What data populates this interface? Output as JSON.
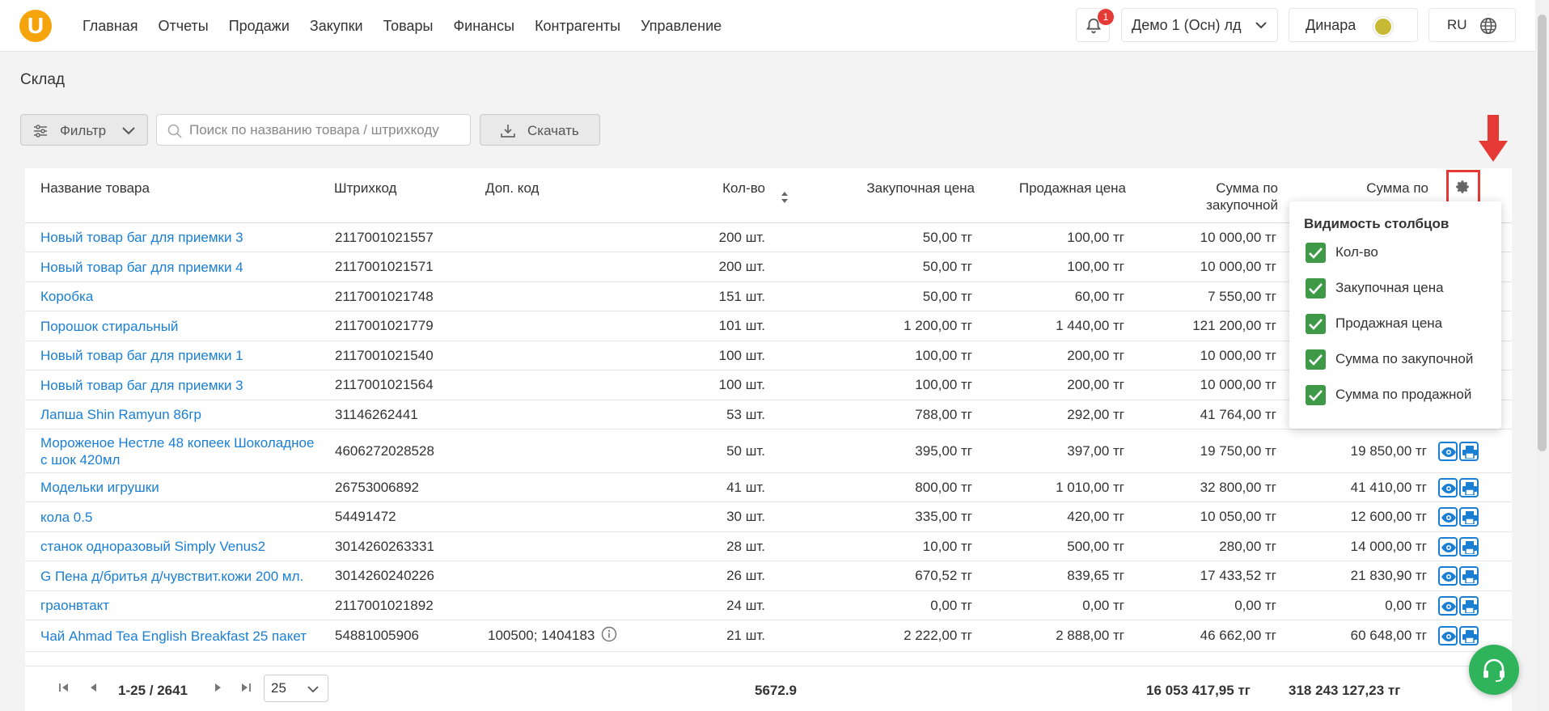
{
  "header": {
    "logo_letter": "U",
    "nav": [
      "Главная",
      "Отчеты",
      "Продажи",
      "Закупки",
      "Товары",
      "Финансы",
      "Контрагенты",
      "Управление"
    ],
    "notifications_count": "1",
    "store": "Демо 1 (Осн) лд",
    "user": "Динара",
    "language": "RU"
  },
  "page": {
    "title": "Склад",
    "filter_label": "Фильтр",
    "search_placeholder": "Поиск по названию товара / штрихкоду",
    "download_label": "Скачать"
  },
  "table": {
    "columns": {
      "name": "Название товара",
      "barcode": "Штрихкод",
      "extra_code": "Доп. код",
      "qty": "Кол-во",
      "purchase_price": "Закупочная цена",
      "sale_price": "Продажная цена",
      "sum_purchase": "Сумма по закупочной",
      "sum_sale": "Сумма по"
    },
    "rows": [
      {
        "name": "Новый товар баг для приемки 3",
        "barcode": "2117001021557",
        "extra": "",
        "qty": "200 шт.",
        "purchase": "50,00 тг",
        "sale": "100,00 тг",
        "sum_purchase": "10 000,00 тг",
        "sum_sale": ""
      },
      {
        "name": "Новый товар баг для приемки 4",
        "barcode": "2117001021571",
        "extra": "",
        "qty": "200 шт.",
        "purchase": "50,00 тг",
        "sale": "100,00 тг",
        "sum_purchase": "10 000,00 тг",
        "sum_sale": ""
      },
      {
        "name": "Коробка",
        "barcode": "2117001021748",
        "extra": "",
        "qty": "151 шт.",
        "purchase": "50,00 тг",
        "sale": "60,00 тг",
        "sum_purchase": "7 550,00 тг",
        "sum_sale": ""
      },
      {
        "name": "Порошок стиральный",
        "barcode": "2117001021779",
        "extra": "",
        "qty": "101 шт.",
        "purchase": "1 200,00 тг",
        "sale": "1 440,00 тг",
        "sum_purchase": "121 200,00 тг",
        "sum_sale": ""
      },
      {
        "name": "Новый товар баг для приемки 1",
        "barcode": "2117001021540",
        "extra": "",
        "qty": "100 шт.",
        "purchase": "100,00 тг",
        "sale": "200,00 тг",
        "sum_purchase": "10 000,00 тг",
        "sum_sale": ""
      },
      {
        "name": "Новый товар баг для приемки 3",
        "barcode": "2117001021564",
        "extra": "",
        "qty": "100 шт.",
        "purchase": "100,00 тг",
        "sale": "200,00 тг",
        "sum_purchase": "10 000,00 тг",
        "sum_sale": ""
      },
      {
        "name": "Лапша Shin Ramyun 86гр",
        "barcode": "31146262441",
        "extra": "",
        "qty": "53 шт.",
        "purchase": "788,00 тг",
        "sale": "292,00 тг",
        "sum_purchase": "41 764,00 тг",
        "sum_sale": ""
      },
      {
        "name": "Мороженое Нестле 48 копеек Шоколадное с шок 420мл",
        "barcode": "4606272028528",
        "extra": "",
        "qty": "50 шт.",
        "purchase": "395,00 тг",
        "sale": "397,00 тг",
        "sum_purchase": "19 750,00 тг",
        "sum_sale": "19 850,00 тг"
      },
      {
        "name": "Модельки игрушки",
        "barcode": "26753006892",
        "extra": "",
        "qty": "41 шт.",
        "purchase": "800,00 тг",
        "sale": "1 010,00 тг",
        "sum_purchase": "32 800,00 тг",
        "sum_sale": "41 410,00 тг"
      },
      {
        "name": "кола 0.5",
        "barcode": "54491472",
        "extra": "",
        "qty": "30 шт.",
        "purchase": "335,00 тг",
        "sale": "420,00 тг",
        "sum_purchase": "10 050,00 тг",
        "sum_sale": "12 600,00 тг"
      },
      {
        "name": "станок одноразовый Simply Venus2",
        "barcode": "3014260263331",
        "extra": "",
        "qty": "28 шт.",
        "purchase": "10,00 тг",
        "sale": "500,00 тг",
        "sum_purchase": "280,00 тг",
        "sum_sale": "14 000,00 тг"
      },
      {
        "name": "G Пена д/бритья д/чувствит.кожи 200 мл.",
        "barcode": "3014260240226",
        "extra": "",
        "qty": "26 шт.",
        "purchase": "670,52 тг",
        "sale": "839,65 тг",
        "sum_purchase": "17 433,52 тг",
        "sum_sale": "21 830,90 тг"
      },
      {
        "name": "граонвтакт",
        "barcode": "2117001021892",
        "extra": "",
        "qty": "24 шт.",
        "purchase": "0,00 тг",
        "sale": "0,00 тг",
        "sum_purchase": "0,00 тг",
        "sum_sale": "0,00 тг"
      },
      {
        "name": "Чай Ahmad Tea English Breakfast 25 пакет",
        "barcode": "54881005906",
        "extra": "100500; 1404183",
        "qty": "21 шт.",
        "purchase": "2 222,00 тг",
        "sale": "2 888,00 тг",
        "sum_purchase": "46 662,00 тг",
        "sum_sale": "60 648,00 тг"
      }
    ]
  },
  "footer": {
    "pagination": "1-25 / 2641",
    "per_page": "25",
    "total_qty": "5672.9",
    "total_purchase": "16 053 417,95 тг",
    "total_sale": "318 243 127,23 тг"
  },
  "column_visibility": {
    "title": "Видимость столбцов",
    "items": [
      "Кол-во",
      "Закупочная цена",
      "Продажная цена",
      "Сумма по закупочной",
      "Сумма по продажной"
    ]
  },
  "colors": {
    "link": "#1a7fd3",
    "accent": "#f5a40c",
    "check": "#3f9a47",
    "highlight": "#e53935",
    "support": "#2fb45c"
  }
}
